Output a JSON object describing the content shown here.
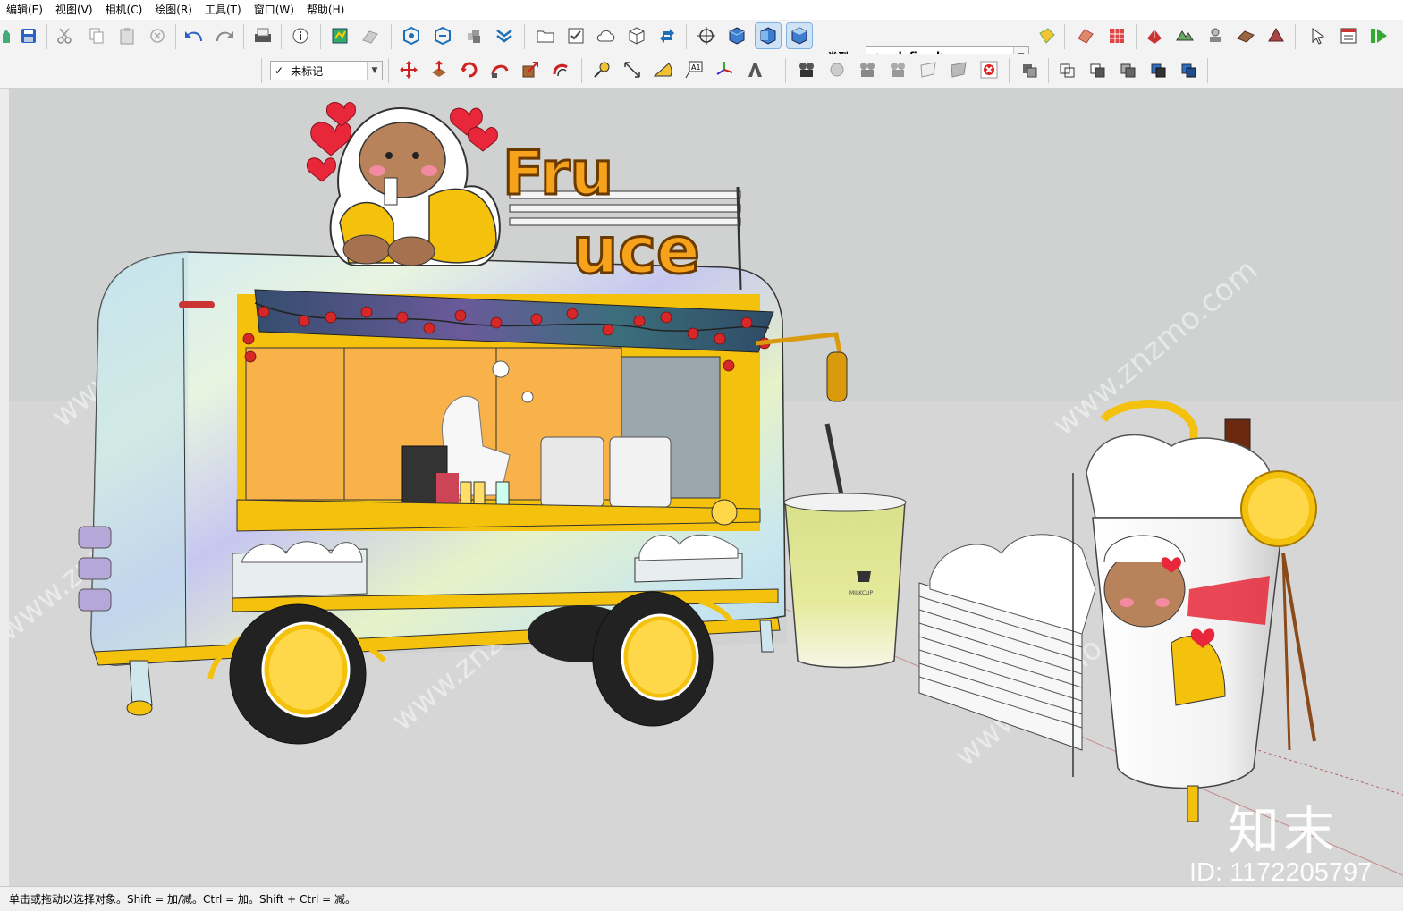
{
  "menu": {
    "items": [
      "编辑(E)",
      "视图(V)",
      "相机(C)",
      "绘图(R)",
      "工具(T)",
      "窗口(W)",
      "帮助(H)"
    ]
  },
  "toolbar": {
    "type_label": "类型：",
    "type_value": "<undefined>",
    "tag_value": "未标记",
    "tag_check": "✓"
  },
  "icons": {
    "save": "save-icon",
    "cut": "cut-icon",
    "copy": "copy-icon",
    "paste": "paste-icon",
    "erase": "erase-icon",
    "undo": "undo-icon",
    "redo": "redo-icon",
    "print": "print-icon",
    "model_info": "info-icon",
    "select": "select-icon",
    "orbit": "orbit-icon"
  },
  "scene": {
    "sign_line1": "Fru",
    "sign_line2": "uce",
    "cup_brand": "MILKCUP"
  },
  "statusbar": {
    "text": "单击或拖动以选择对象。Shift = 加/减。Ctrl = 加。Shift + Ctrl = 减。"
  },
  "watermark": {
    "site": "www.znzmo.com",
    "logo": "知末",
    "id": "ID: 1172205797"
  },
  "colors": {
    "viewport_sky": "#d0d1d1",
    "ground": "#d6d6d6",
    "accent_yellow": "#f4c20d",
    "sign_orange": "#f7a21b",
    "active_button": "#cfe3f7"
  }
}
